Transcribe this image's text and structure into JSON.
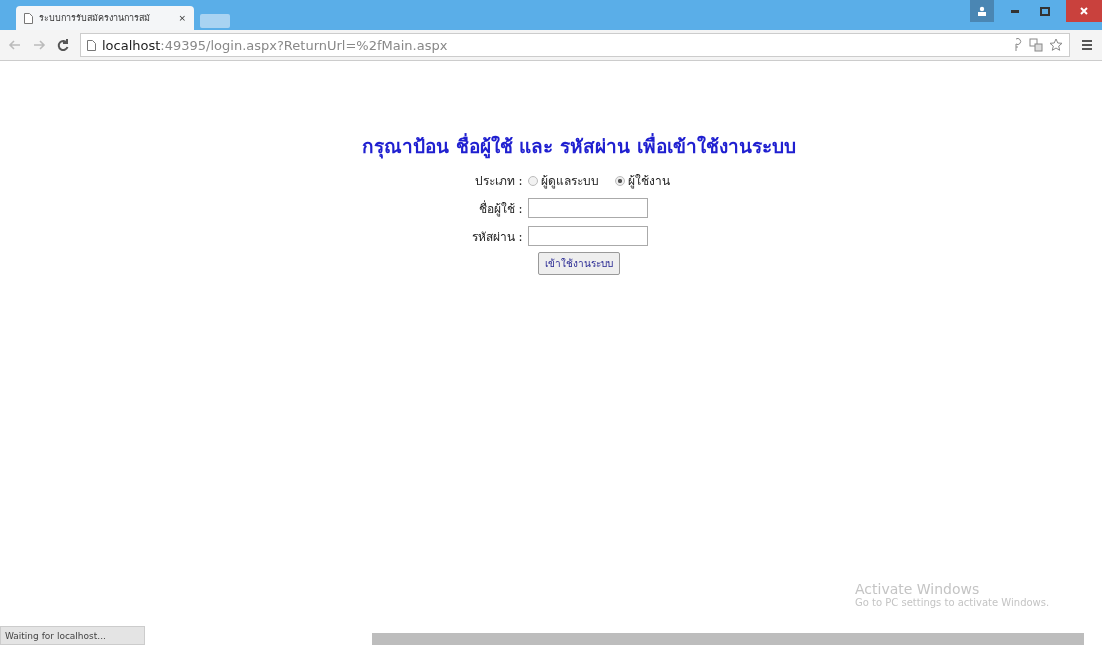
{
  "browser": {
    "tab_title": "ระบบการรับสมัครงานการสมั",
    "tab_close": "×",
    "url_host": "localhost",
    "url_rest": ":49395/login.aspx?ReturnUrl=%2fMain.aspx"
  },
  "heading": "กรุณาป้อน ชื่อผู้ใช้ และ รหัสผ่าน เพื่อเข้าใช้งานระบบ",
  "type_label": "ประเภท :",
  "user_types": [
    {
      "label": "ผู้ดูแลระบบ",
      "selected": false
    },
    {
      "label": "ผู้ใช้งาน",
      "selected": true
    }
  ],
  "fields": [
    {
      "label": "ชื่อผู้ใช้ :"
    },
    {
      "label": "รหัสผ่าน :"
    }
  ],
  "login_button": "เข้าใช้งานระบบ",
  "activation": {
    "title": "Activate Windows",
    "message": "Go to PC settings to activate Windows."
  },
  "status_bar": "Waiting for localhost..."
}
